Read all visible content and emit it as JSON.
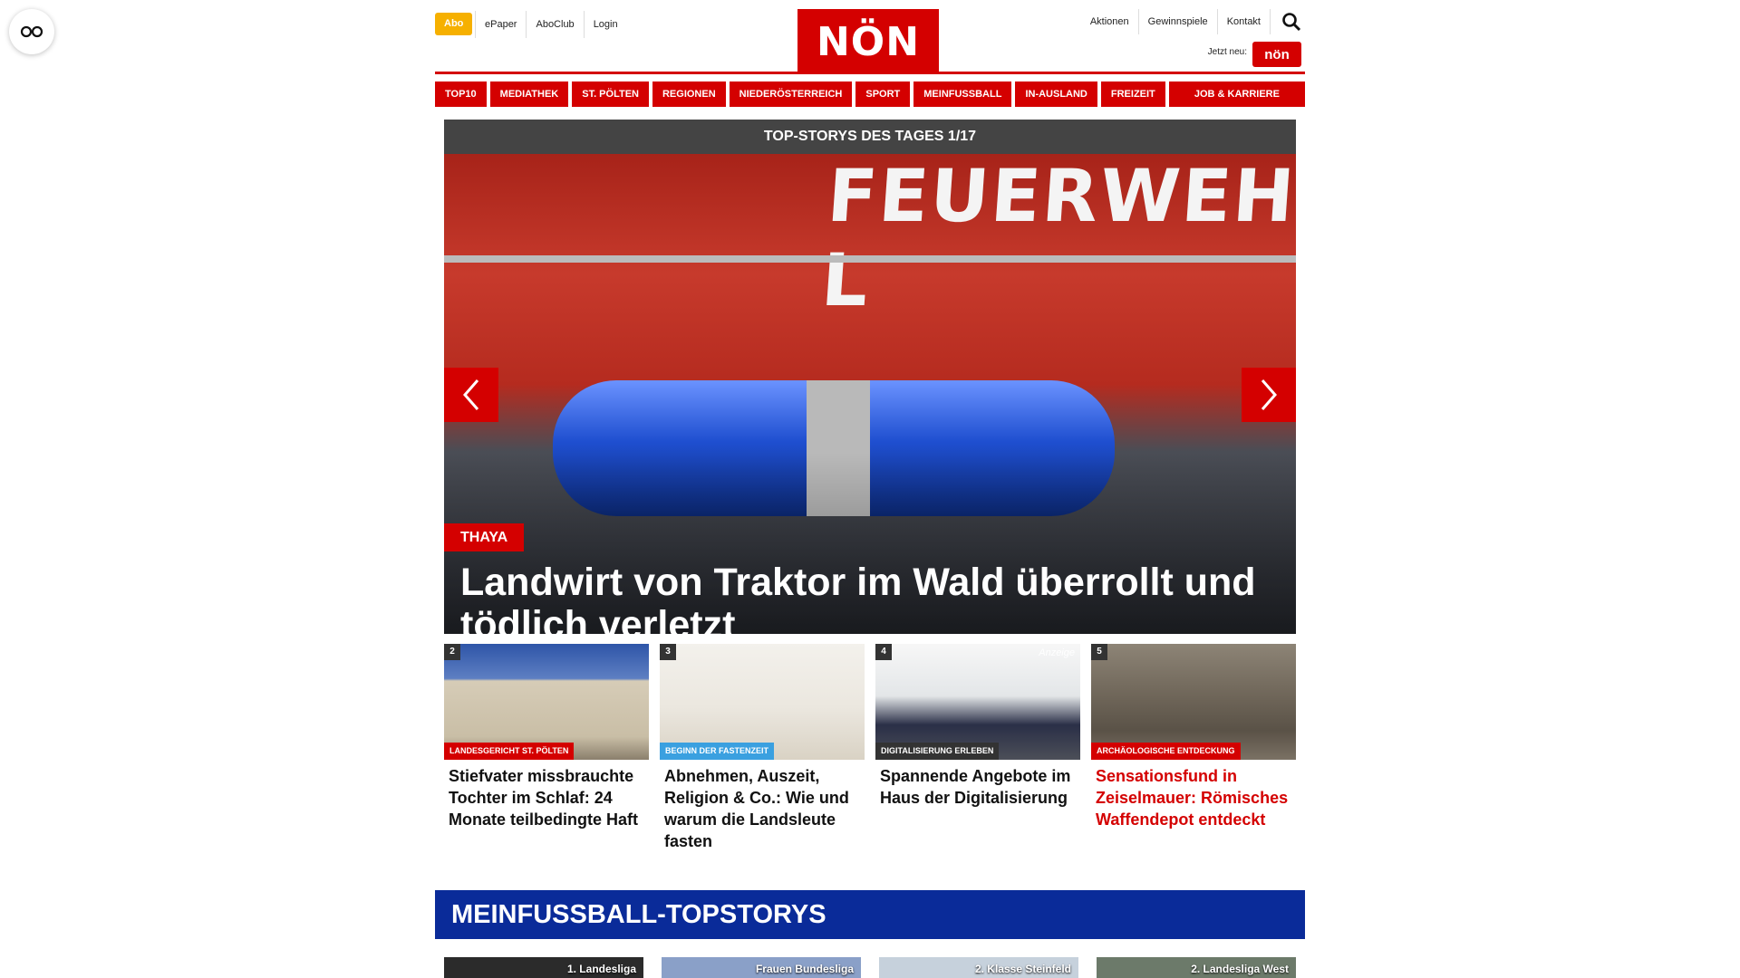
{
  "header": {
    "abo": "Abo",
    "top_links": [
      "ePaper",
      "AboClub",
      "Login"
    ],
    "logo": "NÖN",
    "right_links": [
      "Aktionen",
      "Gewinnspiele",
      "Kontakt"
    ],
    "jetzt_neu": "Jetzt neu:",
    "mini_logo": "nön"
  },
  "nav": [
    "TOP10",
    "MEDIATHEK",
    "ST. PÖLTEN",
    "REGIONEN",
    "NIEDERÖSTERREICH",
    "SPORT",
    "MEINFUSSBALL",
    "IN-AUSLAND",
    "FREIZEIT",
    "JOB & KARRIERE"
  ],
  "hero": {
    "bar_title": "TOP-STORYS DES TAGES 1/17",
    "image_text": "FEUERWEHR L",
    "category": "THAYA",
    "title": "Landwirt von Traktor im Wald überrollt und tödlich verletzt"
  },
  "teasers": [
    {
      "num": "2",
      "tag": "LANDESGERICHT ST. PÖLTEN",
      "title": "Stiefvater missbrauchte Tochter im Schlaf: 24 Monate teilbedingte Haft"
    },
    {
      "num": "3",
      "tag": "BEGINN DER FASTENZEIT",
      "title": "Abnehmen, Auszeit, Religion & Co.: Wie und warum die Landsleute fasten"
    },
    {
      "num": "4",
      "tag": "DIGITALISIERUNG ERLEBEN",
      "title": "Spannende Angebote im Haus der Digitalisierung",
      "anzeige": "Anzeige"
    },
    {
      "num": "5",
      "tag": "ARCHÄOLOGISCHE ENTDECKUNG",
      "title": "Sensationsfund in Zeiselmauer: Römisches Waffendepot entdeckt"
    }
  ],
  "football": {
    "title": "MEINFUSSBALL-TOPSTORYS",
    "cards": [
      "1. Landesliga",
      "Frauen Bundesliga",
      "2. Klasse Steinfeld",
      "2. Landesliga West"
    ]
  },
  "colors": {
    "brand_red": "#d40000",
    "abo_yellow": "#f6b000",
    "football_blue": "#0a2b99"
  }
}
